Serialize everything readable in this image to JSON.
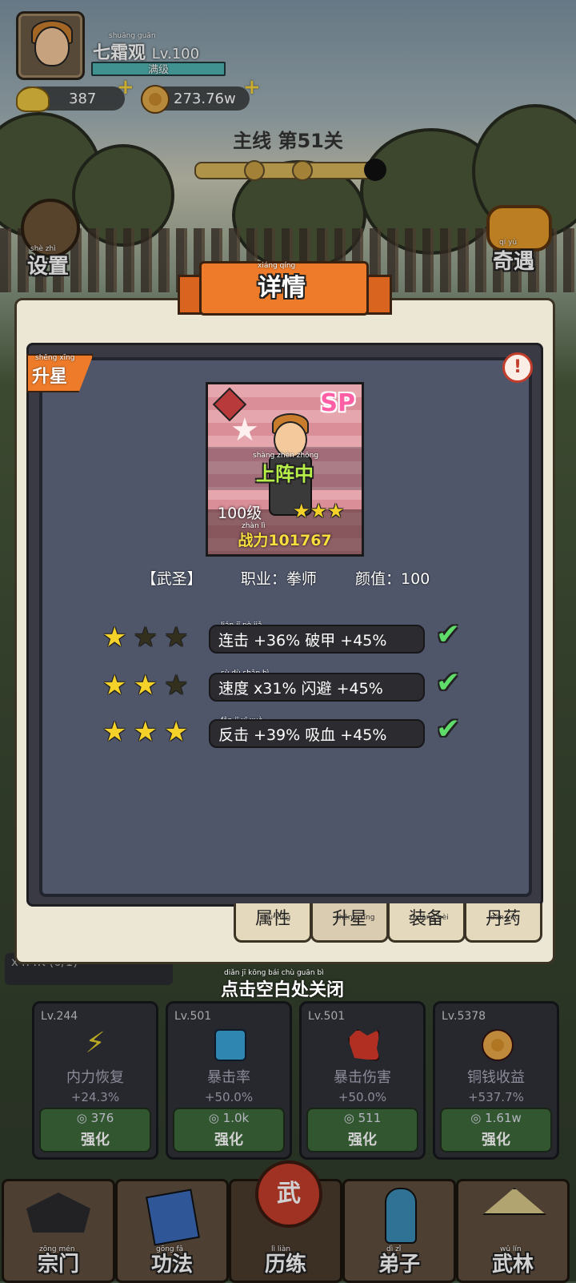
{
  "header": {
    "player_name": "七霜观",
    "player_name_ruby": "shuāng guān",
    "level": "Lv.100",
    "level_status": "满级",
    "gold": "387",
    "coins": "273.76w",
    "chapter": "主线 第51关",
    "progress": 0.8
  },
  "side": {
    "settings": "设置",
    "settings_ruby": "shè  zhì",
    "events": "奇遇",
    "events_ruby": "qí  yù"
  },
  "modal": {
    "title": "详情",
    "title_ruby": "xiáng  qíng",
    "tag": "升星",
    "tag_ruby": "shēng  xīng",
    "info_icon": "!",
    "card": {
      "badge": "SP",
      "status": "上阵中",
      "status_ruby": "shàng  zhèn  zhōng",
      "level": "100级",
      "power": "战力101767",
      "power_ruby": "zhàn lì",
      "stars": 3
    },
    "meta": {
      "title": "【武圣】",
      "title_ruby": "wǔ shèng",
      "job": "职业：拳师",
      "job_ruby": "zhí yè  quán shī",
      "charm": "颜值：100",
      "charm_ruby": "yán zhí"
    },
    "star_rows": [
      {
        "stars": 1,
        "text": "连击 +36%  破甲 +45%",
        "ruby": "lián  jī              pò  jiǎ",
        "done": true
      },
      {
        "stars": 2,
        "text": "速度 x31%  闪避 +45%",
        "ruby": "sù  dù              shǎn  bì",
        "done": true
      },
      {
        "stars": 3,
        "text": "反击 +39%  吸血 +45%",
        "ruby": "fǎn  jī              xī  xuè",
        "done": true
      }
    ],
    "tabs": [
      "属性",
      "升星",
      "装备",
      "丹药"
    ],
    "tabs_ruby": [
      "shǔ  xìng",
      "shēng  xīng",
      "zhuāng  bèi",
      "dān  yào"
    ],
    "close_hint": "点击空白处关闭",
    "close_hint_ruby": "diǎn jī kōng bái chù guān bì"
  },
  "behind": {
    "rate": "x4.4K (0/1)"
  },
  "upgrades": [
    {
      "level": "Lv.244",
      "name": "内力恢复",
      "bonus": "+24.3%",
      "cost": "376",
      "button": "强化",
      "icon": "lightning-icon",
      "color": "#e3cf2a"
    },
    {
      "level": "Lv.501",
      "name": "暴击率",
      "bonus": "+50.0%",
      "cost": "1.0k",
      "button": "强化",
      "icon": "fist-icon",
      "color": "#3aa5d8"
    },
    {
      "level": "Lv.501",
      "name": "暴击伤害",
      "bonus": "+50.0%",
      "cost": "511",
      "button": "强化",
      "icon": "burst-icon",
      "color": "#d83a2a"
    },
    {
      "level": "Lv.5378",
      "name": "铜钱收益",
      "bonus": "+537.7%",
      "cost": "1.61w",
      "button": "强化",
      "icon": "coin-icon",
      "color": "#d8902a"
    }
  ],
  "nav": [
    {
      "label": "宗门",
      "ruby": "zōng mén",
      "icon": "temple-icon"
    },
    {
      "label": "功法",
      "ruby": "gōng fǎ",
      "icon": "book-icon"
    },
    {
      "label": "历练",
      "ruby": "lì liàn",
      "icon": "drum-icon"
    },
    {
      "label": "弟子",
      "ruby": "dì zǐ",
      "icon": "disciple-icon"
    },
    {
      "label": "武林",
      "ruby": "wǔ lín",
      "icon": "swordsman-icon"
    }
  ],
  "colors": {
    "accent_orange": "#ee7b2a",
    "check_green": "#5fdc6a",
    "star_gold": "#f5d22a"
  }
}
